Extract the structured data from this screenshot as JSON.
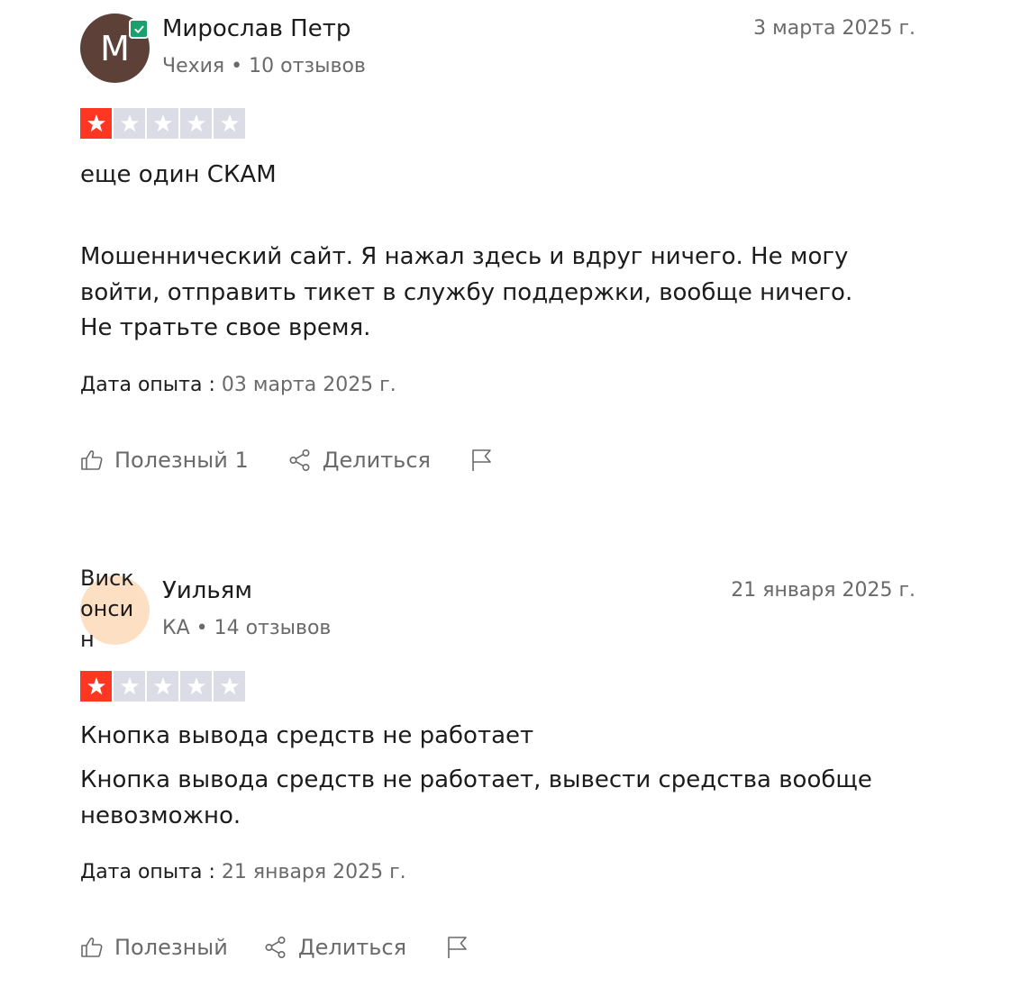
{
  "reviews": [
    {
      "avatar_letter": "M",
      "avatar_color": "#5d4037",
      "verified": true,
      "name": "Мирослав Петр",
      "country": "Чехия",
      "review_count": "10 отзывов",
      "date": "3 марта 2025 г.",
      "rating": 1,
      "title": "еще один СКАМ",
      "body": "Мошеннический сайт. Я нажал здесь и вдруг ничего. Не могу войти, отправить тикет в службу поддержки, вообще ничего. Не тратьте свое время.",
      "experience_label": "Дата опыта :",
      "experience_date": "03 марта 2025 г.",
      "helpful_label": "Полезный 1",
      "share_label": "Делиться"
    },
    {
      "avatar_text": "Висконсин",
      "avatar_color": "#fde0c4",
      "verified": false,
      "name": "Уильям",
      "country": "КА",
      "review_count": "14 отзывов",
      "date": "21 января 2025 г.",
      "rating": 1,
      "title": "Кнопка вывода средств не работает",
      "body": "Кнопка вывода средств не работает, вывести средства вообще невозможно.",
      "experience_label": "Дата опыта :",
      "experience_date": "21 января 2025 г.",
      "helpful_label": "Полезный",
      "share_label": "Делиться"
    }
  ],
  "separator": "•",
  "colors": {
    "star_filled": "#ff3722",
    "star_empty": "#dcdce6",
    "verified": "#1aa06d",
    "muted_text": "#6a6a6a"
  },
  "icons": {
    "helpful": "thumbs-up-icon",
    "share": "share-icon",
    "flag": "flag-icon",
    "verified": "checkmark-icon",
    "star": "star-icon"
  }
}
